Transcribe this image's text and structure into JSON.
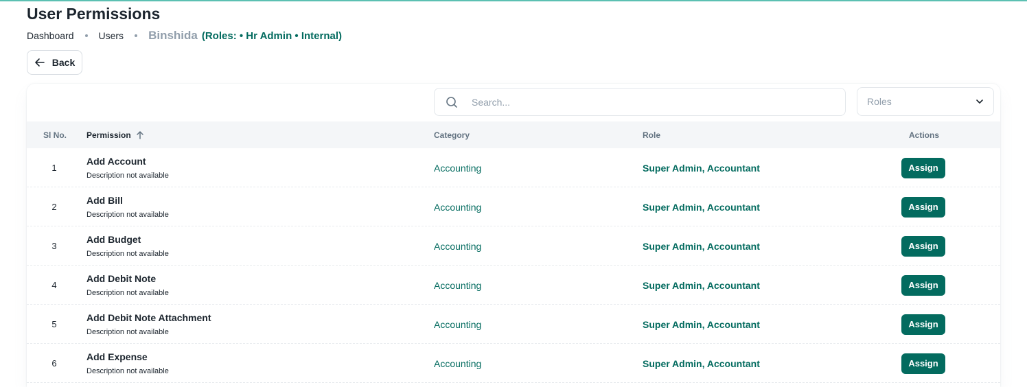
{
  "header": {
    "title": "User Permissions",
    "breadcrumbs": [
      "Dashboard",
      "Users"
    ],
    "current": "Binshida",
    "roles_label": "(Roles: • Hr Admin • Internal)"
  },
  "back_label": "Back",
  "toolbar": {
    "search_placeholder": "Search...",
    "roles_label": "Roles"
  },
  "table": {
    "columns": {
      "sl": "Sl No.",
      "permission": "Permission",
      "category": "Category",
      "role": "Role",
      "actions": "Actions"
    },
    "rows": [
      {
        "sl": "1",
        "name": "Add Account",
        "desc": "Description not available",
        "category": "Accounting",
        "role": "Super Admin, Accountant",
        "action": "Assign"
      },
      {
        "sl": "2",
        "name": "Add Bill",
        "desc": "Description not available",
        "category": "Accounting",
        "role": "Super Admin, Accountant",
        "action": "Assign"
      },
      {
        "sl": "3",
        "name": "Add Budget",
        "desc": "Description not available",
        "category": "Accounting",
        "role": "Super Admin, Accountant",
        "action": "Assign"
      },
      {
        "sl": "4",
        "name": "Add Debit Note",
        "desc": "Description not available",
        "category": "Accounting",
        "role": "Super Admin, Accountant",
        "action": "Assign"
      },
      {
        "sl": "5",
        "name": "Add Debit Note Attachment",
        "desc": "Description not available",
        "category": "Accounting",
        "role": "Super Admin, Accountant",
        "action": "Assign"
      },
      {
        "sl": "6",
        "name": "Add Expense",
        "desc": "Description not available",
        "category": "Accounting",
        "role": "Super Admin, Accountant",
        "action": "Assign"
      }
    ]
  },
  "colors": {
    "accent": "#036b5f",
    "header_bg": "#f4f6f8",
    "top_line": "#5cc0b2"
  }
}
